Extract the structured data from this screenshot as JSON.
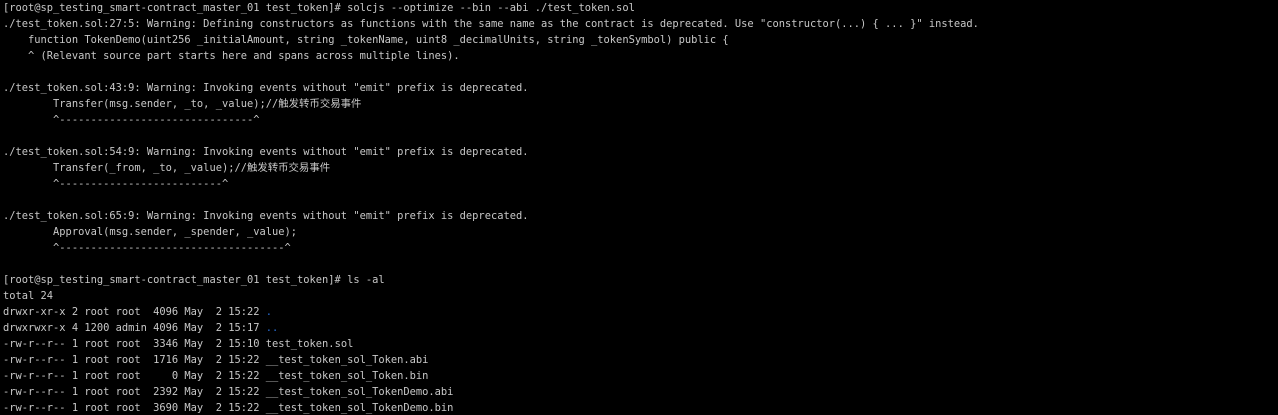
{
  "terminal": {
    "lines": [
      {
        "text": "[root@sp_testing_smart-contract_master_01 test_token]# solcjs --optimize --bin --abi ./test_token.sol"
      },
      {
        "text": "./test_token.sol:27:5: Warning: Defining constructors as functions with the same name as the contract is deprecated. Use \"constructor(...) { ... }\" instead."
      },
      {
        "text": "    function TokenDemo(uint256 _initialAmount, string _tokenName, uint8 _decimalUnits, string _tokenSymbol) public {"
      },
      {
        "text": "    ^ (Relevant source part starts here and spans across multiple lines)."
      },
      {
        "text": ""
      },
      {
        "text": "./test_token.sol:43:9: Warning: Invoking events without \"emit\" prefix is deprecated."
      },
      {
        "text": "        Transfer(msg.sender, _to, _value);//触发转币交易事件"
      },
      {
        "text": "        ^-------------------------------^"
      },
      {
        "text": ""
      },
      {
        "text": "./test_token.sol:54:9: Warning: Invoking events without \"emit\" prefix is deprecated."
      },
      {
        "text": "        Transfer(_from, _to, _value);//触发转币交易事件"
      },
      {
        "text": "        ^--------------------------^"
      },
      {
        "text": ""
      },
      {
        "text": "./test_token.sol:65:9: Warning: Invoking events without \"emit\" prefix is deprecated."
      },
      {
        "text": "        Approval(msg.sender, _spender, _value);"
      },
      {
        "text": "        ^------------------------------------^"
      },
      {
        "text": ""
      },
      {
        "text": "[root@sp_testing_smart-contract_master_01 test_token]# ls -al"
      },
      {
        "text": "total 24"
      }
    ],
    "listing": [
      {
        "meta": "drwxr-xr-x 2 root root  4096 May  2 15:22 ",
        "name": ".",
        "is_dir": true
      },
      {
        "meta": "drwxrwxr-x 4 1200 admin 4096 May  2 15:17 ",
        "name": "..",
        "is_dir": true
      },
      {
        "meta": "-rw-r--r-- 1 root root  3346 May  2 15:10 ",
        "name": "test_token.sol",
        "is_dir": false
      },
      {
        "meta": "-rw-r--r-- 1 root root  1716 May  2 15:22 ",
        "name": "__test_token_sol_Token.abi",
        "is_dir": false
      },
      {
        "meta": "-rw-r--r-- 1 root root     0 May  2 15:22 ",
        "name": "__test_token_sol_Token.bin",
        "is_dir": false
      },
      {
        "meta": "-rw-r--r-- 1 root root  2392 May  2 15:22 ",
        "name": "__test_token_sol_TokenDemo.abi",
        "is_dir": false
      },
      {
        "meta": "-rw-r--r-- 1 root root  3690 May  2 15:22 ",
        "name": "__test_token_sol_TokenDemo.bin",
        "is_dir": false
      }
    ]
  },
  "colors": {
    "background": "#000000",
    "foreground": "#c8c8c8",
    "directory": "#2a6ed6"
  }
}
